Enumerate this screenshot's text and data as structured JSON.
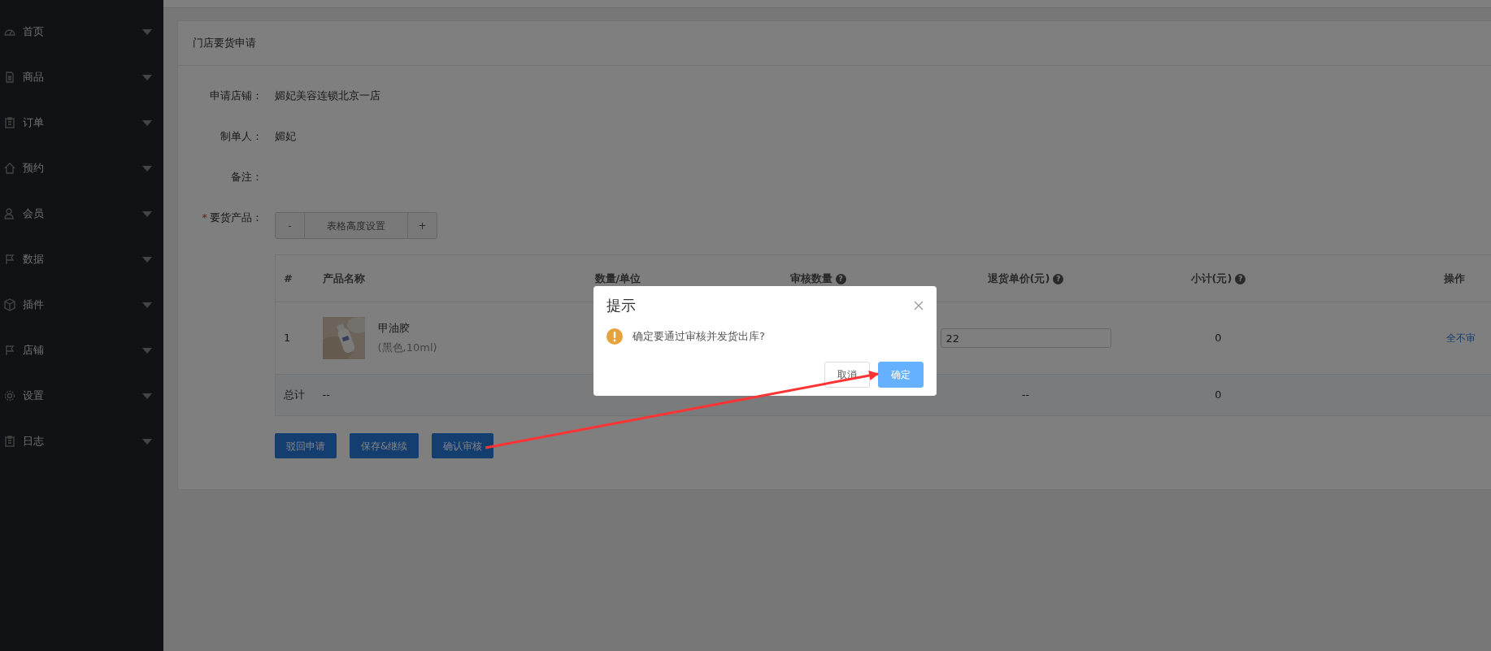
{
  "sidebar": {
    "items": [
      {
        "label": "首页"
      },
      {
        "label": "商品"
      },
      {
        "label": "订单"
      },
      {
        "label": "预约"
      },
      {
        "label": "会员"
      },
      {
        "label": "数据"
      },
      {
        "label": "插件"
      },
      {
        "label": "店铺"
      },
      {
        "label": "设置"
      },
      {
        "label": "日志"
      }
    ]
  },
  "panel": {
    "title": "门店要货申请",
    "fields": [
      {
        "label": "申请店铺：",
        "value": "媚妃美容连锁北京一店"
      },
      {
        "label": "制单人：",
        "value": "媚妃"
      },
      {
        "label": "备注："
      },
      {
        "label": "要货产品：",
        "required_mark": "*"
      }
    ],
    "height_control": {
      "minus": "-",
      "label": "表格高度设置",
      "plus": "+"
    },
    "table": {
      "columns": [
        {
          "label": "#"
        },
        {
          "label": "产品名称"
        },
        {
          "label": "数量/单位"
        },
        {
          "label": "审核数量",
          "help": "?"
        },
        {
          "label": "退货单价(元)",
          "help": "?"
        },
        {
          "label": "小计(元)",
          "help": "?"
        },
        {
          "label": "操作"
        }
      ],
      "rows": [
        {
          "index": "1",
          "name": "甲油胶",
          "spec": "(黑色,10ml)",
          "price": "22",
          "subtotal": "0",
          "actions": [
            "全不审"
          ]
        }
      ],
      "summary": {
        "label": "总计",
        "name": "--",
        "price": "--",
        "subtotal": "0"
      }
    },
    "buttons": [
      "驳回申请",
      "保存&继续",
      "确认审核"
    ]
  },
  "dialog": {
    "title": "提示",
    "message": "确定要通过审核并发货出库?",
    "buttons": [
      {
        "label": "取消",
        "primary": false
      },
      {
        "label": "确定",
        "primary": true
      }
    ]
  }
}
